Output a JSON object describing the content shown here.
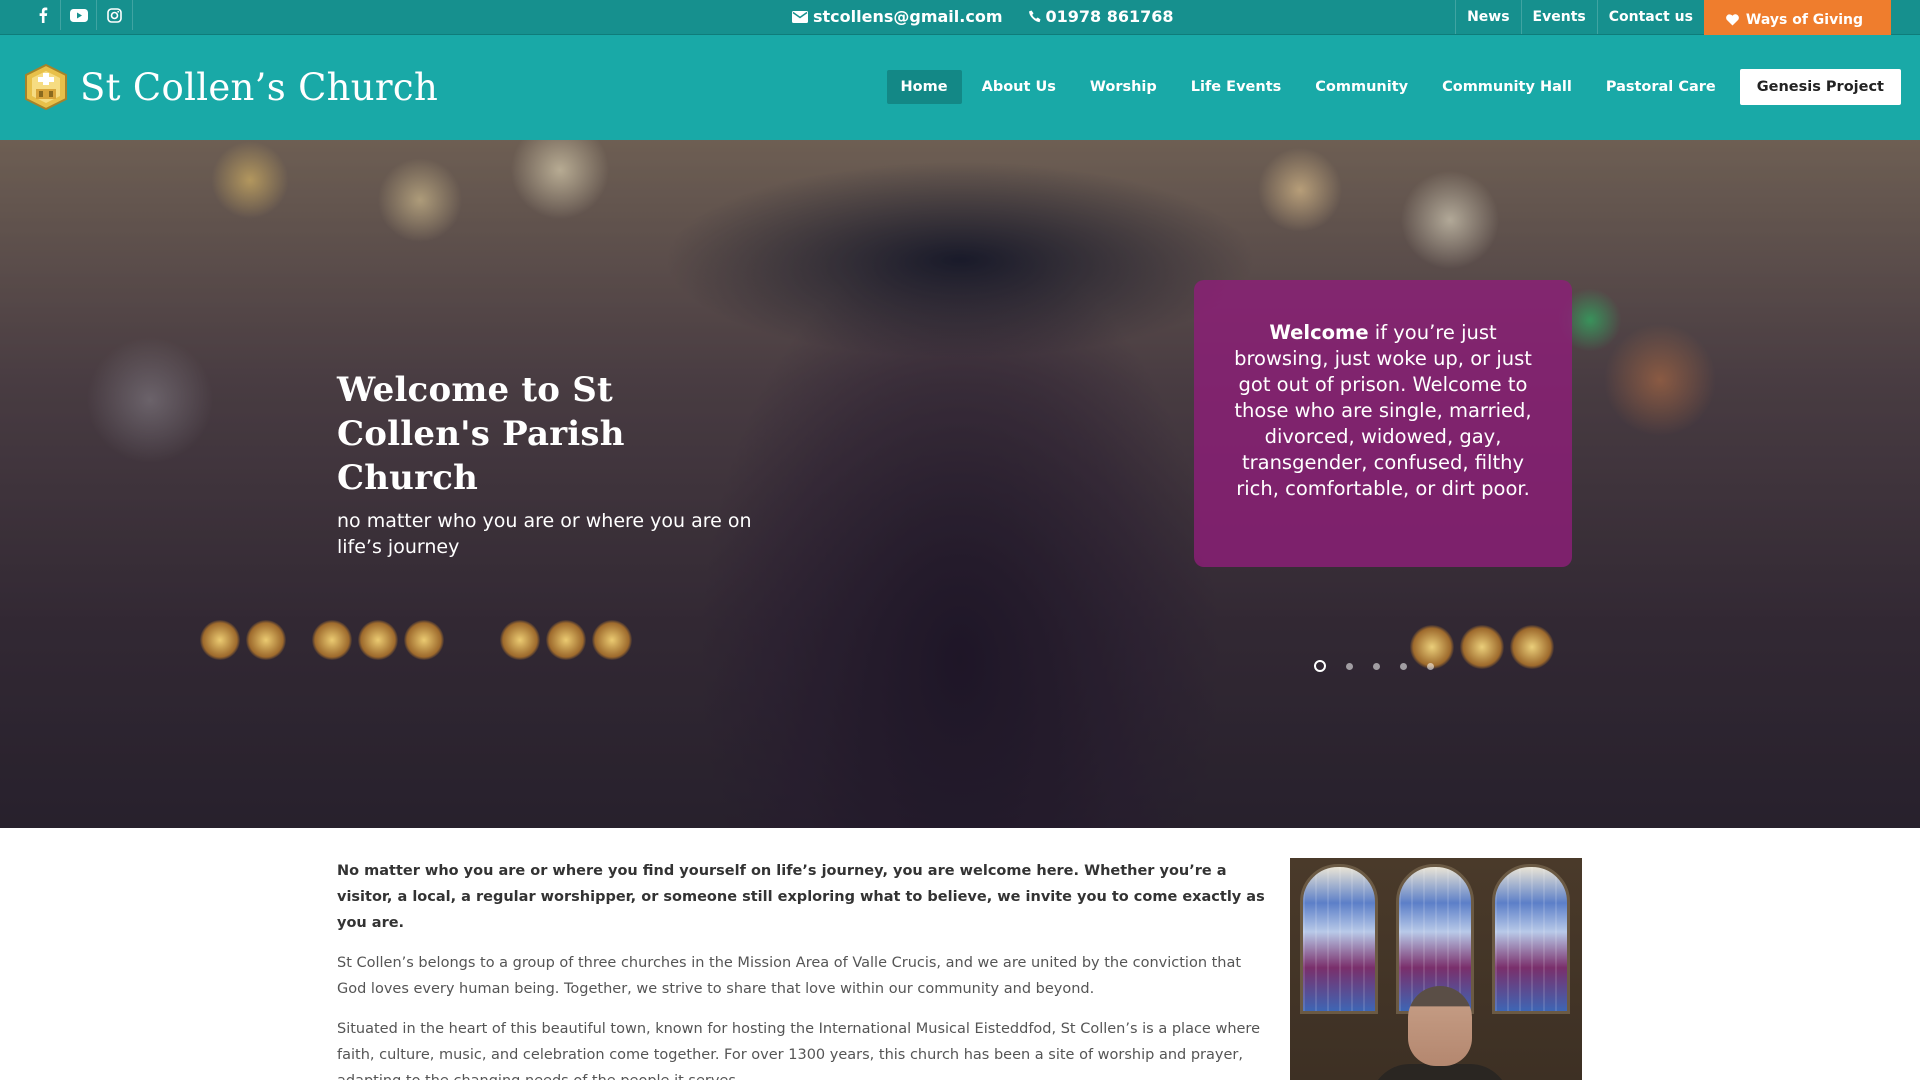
{
  "topbar": {
    "social": [
      {
        "name": "facebook-icon",
        "glyph": "f"
      },
      {
        "name": "youtube-icon",
        "glyph": "▶"
      },
      {
        "name": "instagram-icon",
        "glyph": "◎"
      }
    ],
    "email": "stcollens@gmail.com",
    "phone": "01978 861768",
    "links": [
      "News",
      "Events",
      "Contact us"
    ],
    "giving_label": "Ways of Giving"
  },
  "header": {
    "site_title": "St Collen’s Church",
    "nav": [
      {
        "label": "Home",
        "active": true
      },
      {
        "label": "About Us"
      },
      {
        "label": "Worship"
      },
      {
        "label": "Life Events"
      },
      {
        "label": "Community"
      },
      {
        "label": "Community Hall"
      },
      {
        "label": "Pastoral Care"
      }
    ],
    "cta": "Genesis Project"
  },
  "hero": {
    "title": "Welcome to St Collen's Parish Church",
    "subtitle": "no matter who you are or where you are on life’s journey",
    "card_bold": "Welcome",
    "card_text": " if you’re just browsing, just woke up, or just got out of prison. Welcome to those who are single, married, divorced, widowed, gay, transgender, confused, filthy rich, comfortable, or dirt poor.",
    "slides_total": 5,
    "slide_active": 1
  },
  "content": {
    "lead": "No matter who you are or where you find yourself on life’s journey, you are welcome here. Whether you’re a visitor, a local, a regular worshipper, or someone still exploring what to believe, we invite you to come exactly as you are.",
    "p1": "St Collen’s belongs to a group of three churches in the Mission Area of Valle Crucis, and we are united by the conviction that God loves every human being. Together, we strive to share that love within our community and beyond.",
    "p2": "Situated in the heart of this beautiful town, known for hosting the International Musical Eisteddfod, St Collen’s is a place where faith, culture, music, and celebration come together. For over 1300 years, this church has been a site of worship and prayer, adapting to the changing needs of the people it serves."
  },
  "colors": {
    "topbar": "#16908e",
    "header": "#19a9a7",
    "accent_orange": "#ef7d2d",
    "card_purple": "#8c1e78"
  }
}
